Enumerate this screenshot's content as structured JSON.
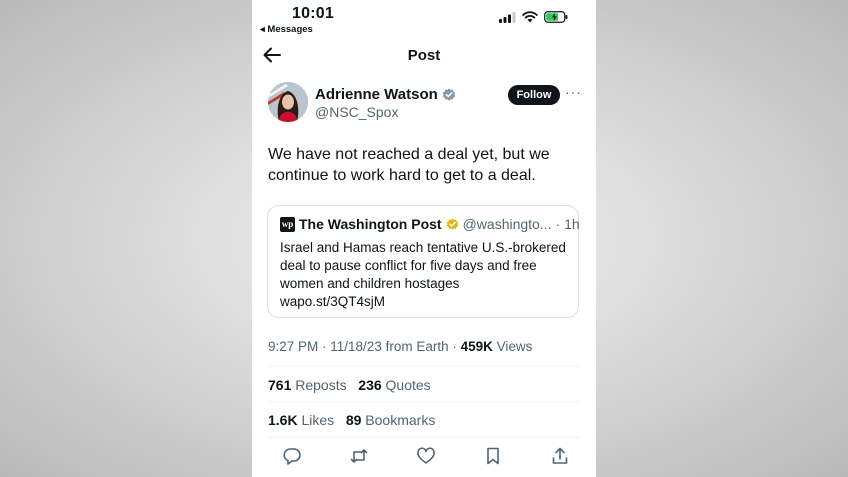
{
  "status_bar": {
    "time": "10:01",
    "back_app": "Messages"
  },
  "header": {
    "title": "Post"
  },
  "author": {
    "name": "Adrienne Watson",
    "handle": "@NSC_Spox",
    "follow_label": "Follow"
  },
  "tweet": {
    "text": "We have not reached a deal yet, but we continue to work hard to get to a deal."
  },
  "quote": {
    "logo": "wp",
    "name": "The Washington Post",
    "handle": "@washingto...",
    "age": "· 1h",
    "body": "Israel and Hamas reach tentative U.S.-brokered deal to pause conflict for five days and free women and children hostages",
    "link": "wapo.st/3QT4sjM"
  },
  "meta": {
    "timestamp": "9:27 PM · 11/18/23 from Earth · ",
    "views_count": "459K",
    "views_label": " Views"
  },
  "stats": {
    "reposts_count": "761",
    "reposts_label": " Reposts",
    "quotes_count": "236",
    "quotes_label": " Quotes",
    "likes_count": "1.6K",
    "likes_label": " Likes",
    "bookmarks_count": "89",
    "bookmarks_label": " Bookmarks"
  },
  "icons": [
    "back-arrow-icon",
    "verified-badge-icon",
    "reply-icon",
    "repost-icon",
    "like-icon",
    "bookmark-icon",
    "share-icon"
  ],
  "colors": {
    "verified": "#829aab",
    "gold_verified": "#e2b719",
    "battery": "#34c759",
    "text": "#0f1419",
    "muted": "#536471"
  }
}
